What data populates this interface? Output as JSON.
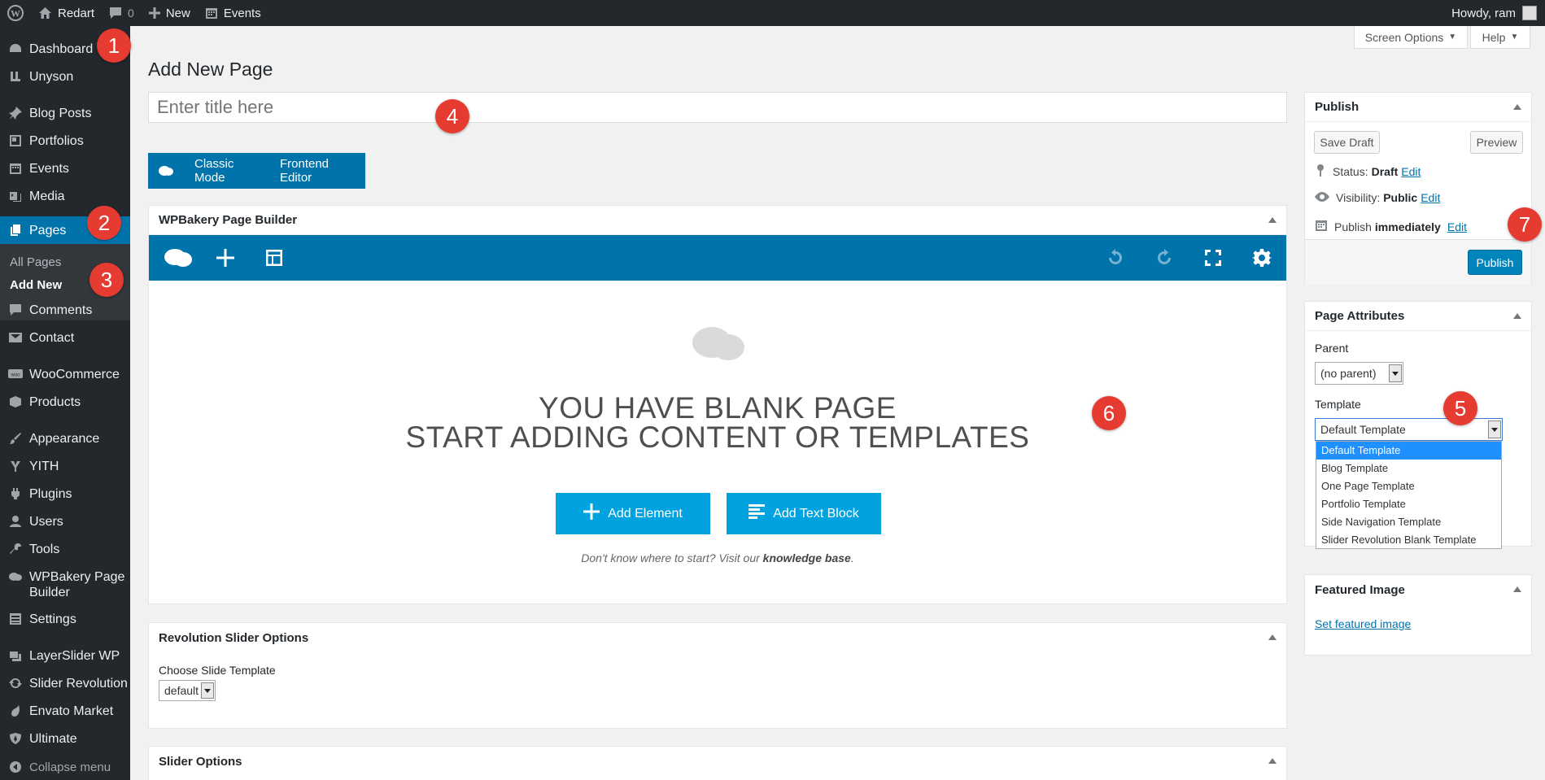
{
  "admin_bar": {
    "site_name": "Redart",
    "comments_count": "0",
    "new_label": "New",
    "events_label": "Events",
    "howdy": "Howdy, ram"
  },
  "sidebar": {
    "items": [
      {
        "label": "Dashboard"
      },
      {
        "label": "Unyson"
      },
      {
        "label": "Blog Posts"
      },
      {
        "label": "Portfolios"
      },
      {
        "label": "Events"
      },
      {
        "label": "Media"
      },
      {
        "label": "Pages"
      },
      {
        "label": "Comments"
      },
      {
        "label": "Contact"
      },
      {
        "label": "WooCommerce"
      },
      {
        "label": "Products"
      },
      {
        "label": "Appearance"
      },
      {
        "label": "YITH"
      },
      {
        "label": "Plugins"
      },
      {
        "label": "Users"
      },
      {
        "label": "Tools"
      },
      {
        "label": "WPBakery Page\nBuilder"
      },
      {
        "label": "Settings"
      },
      {
        "label": "LayerSlider WP"
      },
      {
        "label": "Slider Revolution"
      },
      {
        "label": "Envato Market"
      },
      {
        "label": "Ultimate"
      }
    ],
    "submenu": [
      {
        "label": "All Pages"
      },
      {
        "label": "Add New"
      }
    ],
    "collapse_label": "Collapse menu"
  },
  "screen_options_label": "Screen Options",
  "help_label": "Help",
  "page_title": "Add New Page",
  "title_placeholder": "Enter title here",
  "mode_bar": {
    "classic": "Classic Mode",
    "frontend": "Frontend Editor"
  },
  "wpbakery": {
    "title": "WPBakery Page Builder",
    "blank_line1": "YOU HAVE BLANK PAGE",
    "blank_line2": "START ADDING CONTENT OR TEMPLATES",
    "add_element": "Add Element",
    "add_text_block": "Add Text Block",
    "kb_text": "Don't know where to start? Visit our",
    "kb_link": "knowledge base",
    "kb_end": "."
  },
  "rev_slider": {
    "title": "Revolution Slider Options",
    "choose_label": "Choose Slide Template",
    "value": "default"
  },
  "slider_options": {
    "title": "Slider Options"
  },
  "publish": {
    "title": "Publish",
    "save_draft": "Save Draft",
    "preview": "Preview",
    "status_label": "Status:",
    "status_value": "Draft",
    "visibility_label": "Visibility:",
    "visibility_value": "Public",
    "publish_label": "Publish",
    "publish_value": "immediately",
    "edit": "Edit",
    "publish_button": "Publish"
  },
  "page_attributes": {
    "title": "Page Attributes",
    "parent_label": "Parent",
    "parent_value": "(no parent)",
    "template_label": "Template",
    "template_value": "Default Template",
    "template_options": [
      "Default Template",
      "Blog Template",
      "One Page Template",
      "Portfolio Template",
      "Side Navigation Template",
      "Slider Revolution Blank Template"
    ]
  },
  "featured_image": {
    "title": "Featured Image",
    "link": "Set featured image"
  },
  "badges": [
    "1",
    "2",
    "3",
    "4",
    "5",
    "6",
    "7"
  ],
  "colors": {
    "admin_dark": "#23282d",
    "wp_blue": "#0073aa",
    "vc_cyan": "#00a3e0",
    "badge_red": "#e53b30"
  }
}
